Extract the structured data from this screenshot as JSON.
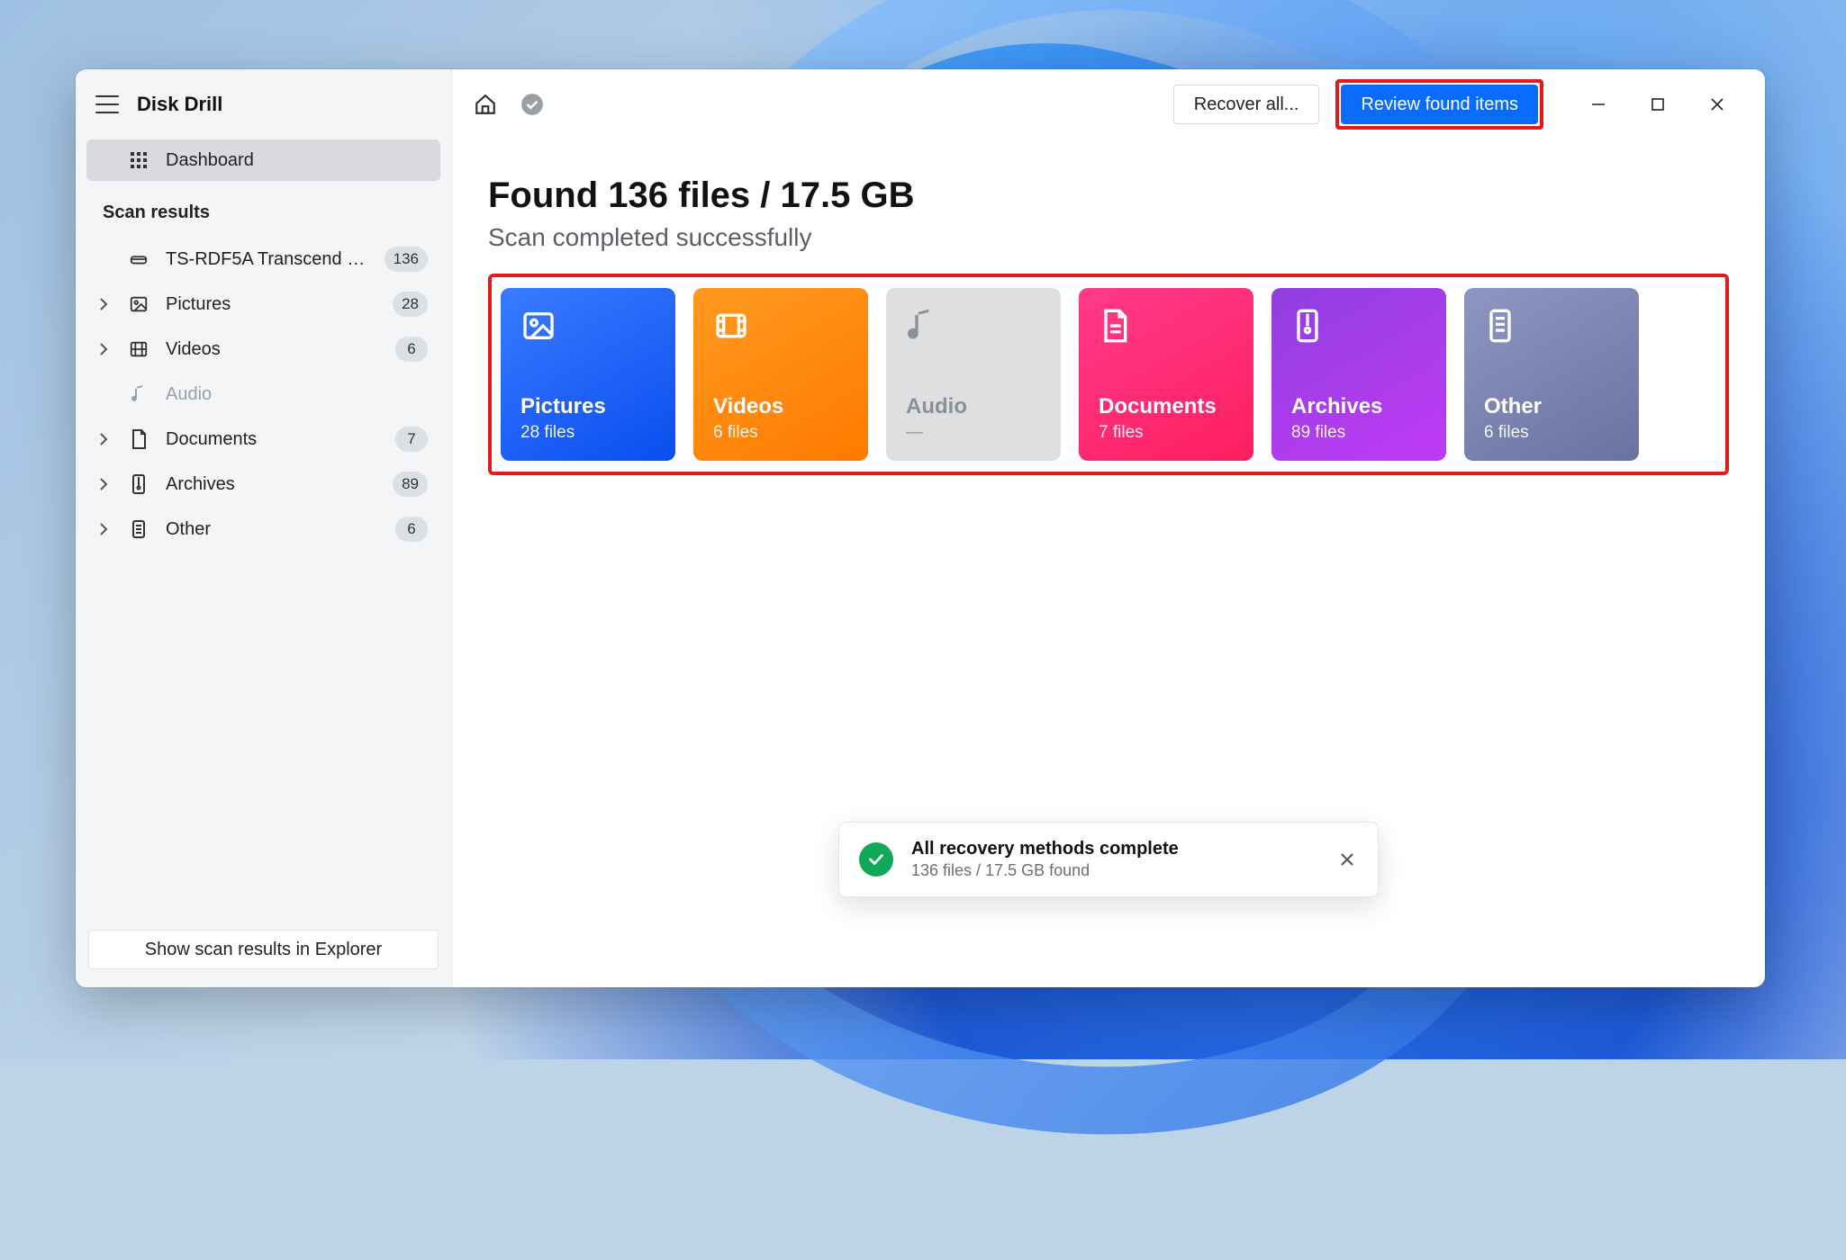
{
  "app": {
    "title": "Disk Drill"
  },
  "sidebar": {
    "dashboard_label": "Dashboard",
    "scan_results_heading": "Scan results",
    "device": {
      "label": "TS-RDF5A Transcend US...",
      "count": "136"
    },
    "items": [
      {
        "label": "Pictures",
        "count": "28"
      },
      {
        "label": "Videos",
        "count": "6"
      },
      {
        "label": "Audio",
        "count": ""
      },
      {
        "label": "Documents",
        "count": "7"
      },
      {
        "label": "Archives",
        "count": "89"
      },
      {
        "label": "Other",
        "count": "6"
      }
    ],
    "footer_button": "Show scan results in Explorer"
  },
  "toolbar": {
    "recover_all_label": "Recover all...",
    "review_label": "Review found items"
  },
  "main": {
    "headline": "Found 136 files / 17.5 GB",
    "subline": "Scan completed successfully"
  },
  "cards": {
    "pictures": {
      "title": "Pictures",
      "sub": "28 files"
    },
    "videos": {
      "title": "Videos",
      "sub": "6 files"
    },
    "audio": {
      "title": "Audio",
      "sub": "—"
    },
    "documents": {
      "title": "Documents",
      "sub": "7 files"
    },
    "archives": {
      "title": "Archives",
      "sub": "89 files"
    },
    "other": {
      "title": "Other",
      "sub": "6 files"
    }
  },
  "toast": {
    "title": "All recovery methods complete",
    "sub": "136 files / 17.5 GB found"
  }
}
